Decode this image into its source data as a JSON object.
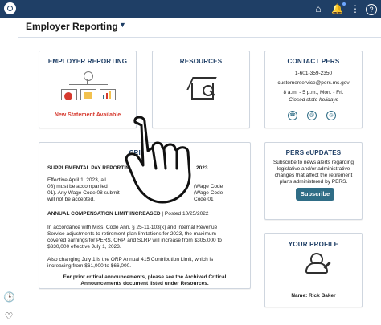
{
  "app": {
    "page_title": "Employer Reporting"
  },
  "sidebar": {
    "icons": [
      {
        "name": "history-icon"
      },
      {
        "name": "favorite-icon"
      }
    ]
  },
  "topbar": {
    "icons": [
      "home-icon",
      "bell-icon",
      "menu-icon"
    ]
  },
  "tiles": {
    "employer_reporting": {
      "title": "EMPLOYER REPORTING",
      "notice": "New Statement Available"
    },
    "resources": {
      "title": "RESOURCES"
    },
    "contact": {
      "title": "CONTACT PERS",
      "phone": "1-601-359-2350",
      "email": "customerservice@pers.ms.gov",
      "hours_1": "8 a.m. - 5 p.m., Mon. - Fri.",
      "hours_2": "Closed state holidays"
    },
    "critical": {
      "title_fragment": "CRITICAL",
      "sec1_heading": "SUPPLEMENTAL PAY REPORTING",
      "sec1_suffix": "2023",
      "sec1_body_1": "Effective April 1, 2023, all",
      "sec1_body_2": "08) must be accompanied",
      "sec1_body_3": "01). Any Wage Code 08 submit",
      "sec1_body_4": "will not be accepted.",
      "sec1_right_1": "(Wage Code",
      "sec1_right_2": "(Wage Code",
      "sec1_right_3": "Code 01",
      "sec2_heading": "ANNUAL COMPENSATION LIMIT INCREASED",
      "sec2_posted": " | Posted 10/25/2022",
      "sec2_body_1": "In accordance with Miss. Code Ann. § 25-11-103(k) and Internal Revenue",
      "sec2_body_2": "Service adjustments to retirement plan limitations for 2023, the maximum",
      "sec2_body_3": "covered earnings for PERS, ORP, and SLRP will increase from $305,000 to",
      "sec2_body_4": "$330,000 effective July 1, 2023.",
      "sec3_body_1": "Also changing July 1 is the ORP Annual 415 Contribution Limit, which is",
      "sec3_body_2": "increasing from $61,000 to $66,000.",
      "footer_1": "For prior critical announcements, please see the Archived Critical",
      "footer_2": "Announcements document listed under Resources."
    },
    "pers_eupdates": {
      "title": "PERS eUPDATES",
      "body_1": "Subscribe to news alerts regarding",
      "body_2": "legislative and/or administrative",
      "body_3": "changes that affect the retirement",
      "body_4": "plans administered by PERS.",
      "button": "Subscribe"
    },
    "profile": {
      "title": "YOUR PROFILE",
      "name_line": "Name: Rick Baker"
    }
  }
}
